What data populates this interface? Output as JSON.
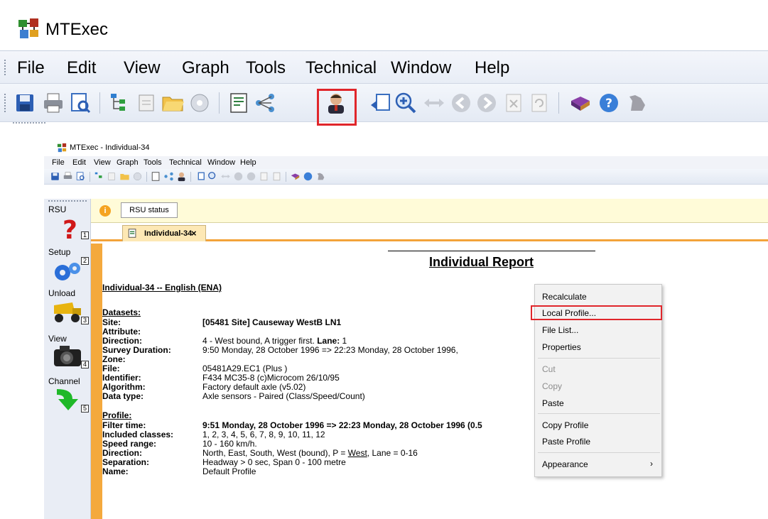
{
  "zoom": {
    "app_title": "MTExec",
    "menu": [
      "File",
      "Edit",
      "View",
      "Graph",
      "Tools",
      "Technical",
      "Window",
      "Help"
    ]
  },
  "window": {
    "title": "MTExec - Individual-34",
    "menu": [
      "File",
      "Edit",
      "View",
      "Graph",
      "Tools",
      "Technical",
      "Window",
      "Help"
    ]
  },
  "sidebar": {
    "items": [
      {
        "label": "RSU",
        "num": "1",
        "icon": "question-icon"
      },
      {
        "label": "Setup",
        "num": "2",
        "icon": "gears-icon"
      },
      {
        "label": "Unload",
        "num": "3",
        "icon": "dump-truck-icon"
      },
      {
        "label": "View",
        "num": "4",
        "icon": "camera-icon"
      },
      {
        "label": "Channel",
        "num": "5",
        "icon": "green-arrow-icon"
      }
    ]
  },
  "status": {
    "button": "RSU status",
    "icon": "info-icon"
  },
  "tab": {
    "label": "Individual-34",
    "close": "×"
  },
  "report": {
    "title": "Individual Report",
    "heading": "Individual-34 -- English (ENA)",
    "datasets_header": "Datasets:",
    "datasets": [
      {
        "k": "Site:",
        "v": "[05481 Site] Causeway WestB LN1",
        "bold": true
      },
      {
        "k": "Attribute:",
        "v": ""
      },
      {
        "k": "Direction:",
        "v": "4 - West bound, A trigger first. Lane: 1"
      },
      {
        "k": "Survey Duration:",
        "v": "9:50 Monday, 28 October 1996 => 22:23 Monday, 28 October 1996,"
      },
      {
        "k": "Zone:",
        "v": ""
      },
      {
        "k": "File:",
        "v": "05481A29.EC1 (Plus )"
      },
      {
        "k": "Identifier:",
        "v": "F434 MC35-8 (c)Microcom 26/10/95"
      },
      {
        "k": "Algorithm:",
        "v": "Factory default axle (v5.02)"
      },
      {
        "k": "Data type:",
        "v": "Axle sensors - Paired (Class/Speed/Count)"
      }
    ],
    "profile_header": "Profile:",
    "profile": [
      {
        "k": "Filter time:",
        "v": "9:51 Monday, 28 October 1996 => 22:23 Monday, 28 October 1996 (0.5",
        "bold": true
      },
      {
        "k": "Included classes:",
        "v": "1, 2, 3, 4, 5, 6, 7, 8, 9, 10, 11, 12"
      },
      {
        "k": "Speed range:",
        "v": "10 - 160 km/h."
      },
      {
        "k": "Direction:",
        "v": "North, East, South, West (bound), P = West, Lane = 0-16"
      },
      {
        "k": "Separation:",
        "v": "Headway > 0 sec, Span 0 - 100 metre"
      },
      {
        "k": "Name:",
        "v": "Default Profile"
      }
    ]
  },
  "context_menu": {
    "items": [
      {
        "label": "Recalculate",
        "enabled": true
      },
      {
        "label": "Local Profile...",
        "enabled": true,
        "highlighted": true
      },
      {
        "label": "File List...",
        "enabled": true
      },
      {
        "label": "Properties",
        "enabled": true
      },
      {
        "label": "Cut",
        "enabled": false
      },
      {
        "label": "Copy",
        "enabled": false
      },
      {
        "label": "Paste",
        "enabled": true
      },
      {
        "label": "Copy Profile",
        "enabled": true
      },
      {
        "label": "Paste Profile",
        "enabled": true
      },
      {
        "label": "Appearance",
        "enabled": true,
        "submenu": true
      }
    ],
    "submenu_arrow": "›"
  },
  "colors": {
    "highlight": "#e0262b",
    "tab_accent": "#f4a93d",
    "status_bg": "#fffbd8"
  }
}
